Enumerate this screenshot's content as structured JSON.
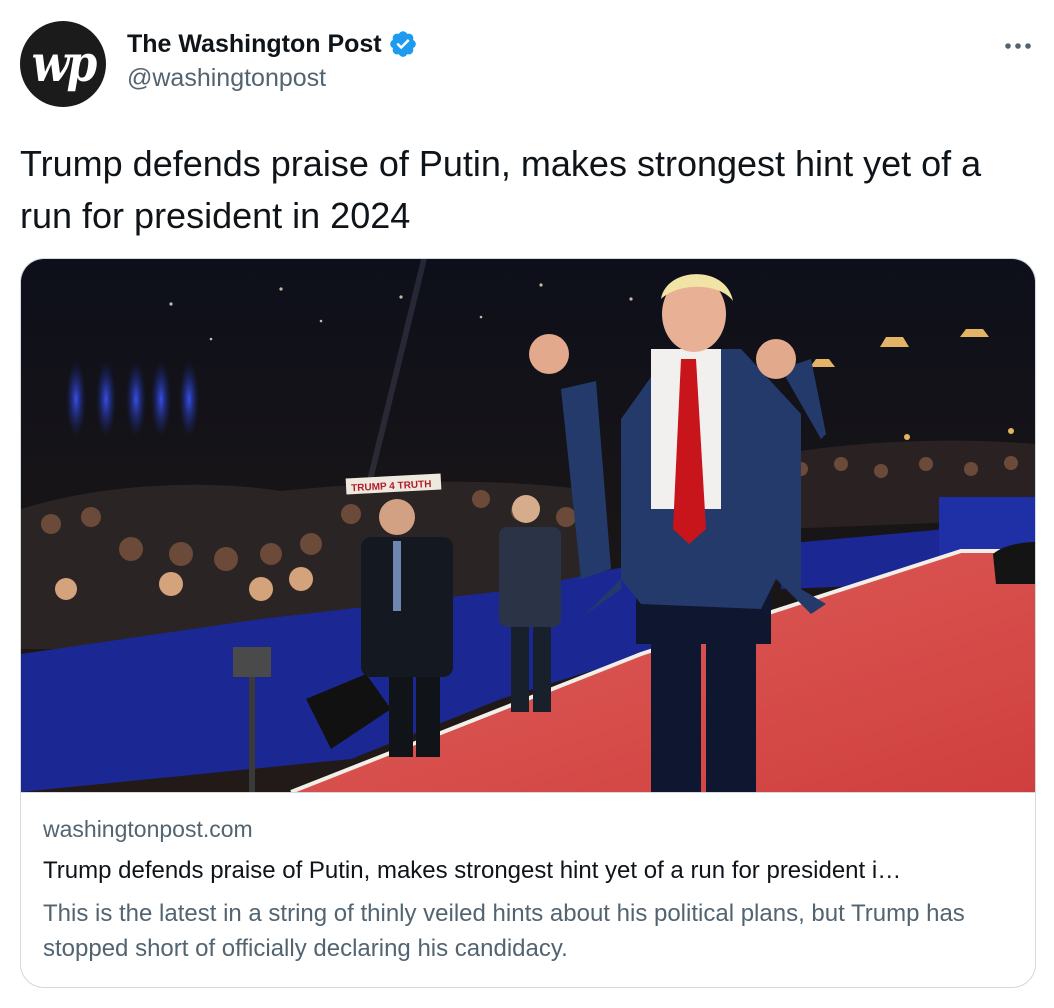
{
  "author": {
    "display_name": "The Washington Post",
    "handle": "@washingtonpost",
    "avatar_monogram": "wp",
    "verified": true,
    "verified_icon": "verified-badge-icon",
    "verified_color": "#1d9bf0"
  },
  "menu": {
    "icon": "more-horizontal-icon"
  },
  "tweet": {
    "text": "Trump defends praise of Putin, makes strongest hint yet of a run for president in 2024"
  },
  "card": {
    "image_subject": "photo-trump-on-stage",
    "image_sign_text": "TRUMP 4 TRUTH",
    "domain": "washingtonpost.com",
    "title": "Trump defends praise of Putin, makes strongest hint yet of a run for president i…",
    "description": "This is the latest in a string of thinly veiled hints about his political plans, but Trump has stopped short of officially declaring his candidacy."
  },
  "colors": {
    "text_primary": "#0f1419",
    "text_secondary": "#536471",
    "border": "#cfd9de",
    "carpet_red": "#d9504c",
    "stage_blue": "#1a2a8c"
  }
}
